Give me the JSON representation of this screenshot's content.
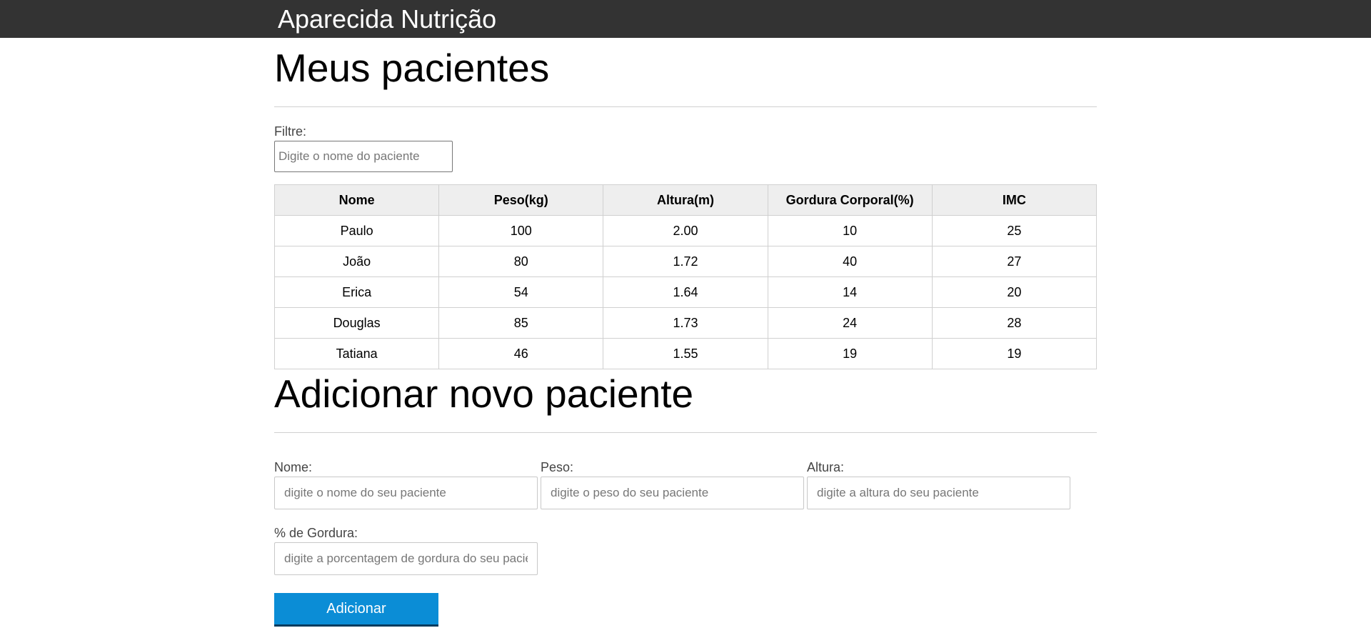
{
  "header": {
    "brand": "Aparecida Nutrição"
  },
  "patients_section": {
    "title": "Meus pacientes",
    "filter_label": "Filtre:",
    "filter_placeholder": "Digite o nome do paciente"
  },
  "table": {
    "columns": [
      "Nome",
      "Peso(kg)",
      "Altura(m)",
      "Gordura Corporal(%)",
      "IMC"
    ],
    "rows": [
      [
        "Paulo",
        "100",
        "2.00",
        "10",
        "25"
      ],
      [
        "João",
        "80",
        "1.72",
        "40",
        "27"
      ],
      [
        "Erica",
        "54",
        "1.64",
        "14",
        "20"
      ],
      [
        "Douglas",
        "85",
        "1.73",
        "24",
        "28"
      ],
      [
        "Tatiana",
        "46",
        "1.55",
        "19",
        "19"
      ]
    ]
  },
  "form": {
    "title": "Adicionar novo paciente",
    "nome_label": "Nome:",
    "nome_placeholder": "digite o nome do seu paciente",
    "peso_label": "Peso:",
    "peso_placeholder": "digite o peso do seu paciente",
    "altura_label": "Altura:",
    "altura_placeholder": "digite a altura do seu paciente",
    "gordura_label": "% de Gordura:",
    "gordura_placeholder": "digite a porcentagem de gordura do seu paciente",
    "submit_label": "Adicionar"
  },
  "colors": {
    "header_bg": "#333333",
    "button_bg": "#0b8dd6",
    "table_header_bg": "#eeeeee"
  }
}
